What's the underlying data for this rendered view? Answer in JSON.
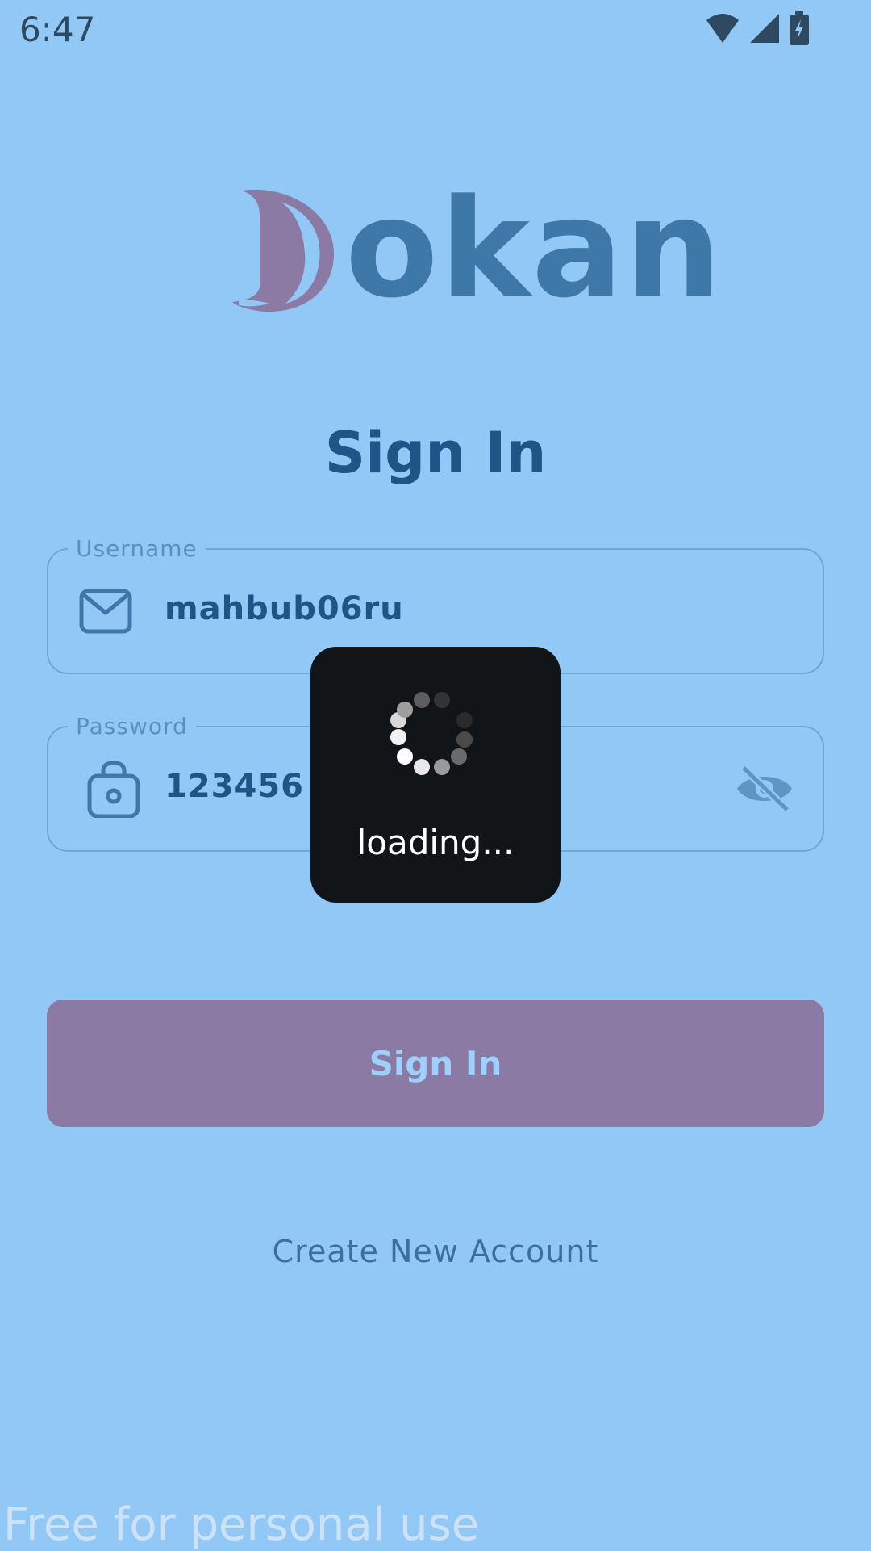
{
  "status_bar": {
    "time": "6:47",
    "icons": [
      "wifi-icon",
      "signal-icon",
      "battery-charging-icon"
    ]
  },
  "logo": {
    "letter": "D",
    "rest": "okan",
    "colors": {
      "letter": "#8b7aa4",
      "rest": "#3e78a8"
    }
  },
  "title": "Sign In",
  "username": {
    "label": "Username",
    "value": "mahbub06ru",
    "icon": "mail-icon"
  },
  "password": {
    "label": "Password",
    "value": "123456",
    "icon": "lock-icon",
    "toggle_icon": "eye-off-icon"
  },
  "signin_button": {
    "label": "Sign In"
  },
  "create_account": {
    "label": "Create New Account"
  },
  "loading": {
    "text": "loading..."
  },
  "watermark": "Free for personal use",
  "colors": {
    "background": "#91c8f6",
    "primary": "#1f5486",
    "button": "#8b7aa4",
    "overlay": "#111518"
  }
}
